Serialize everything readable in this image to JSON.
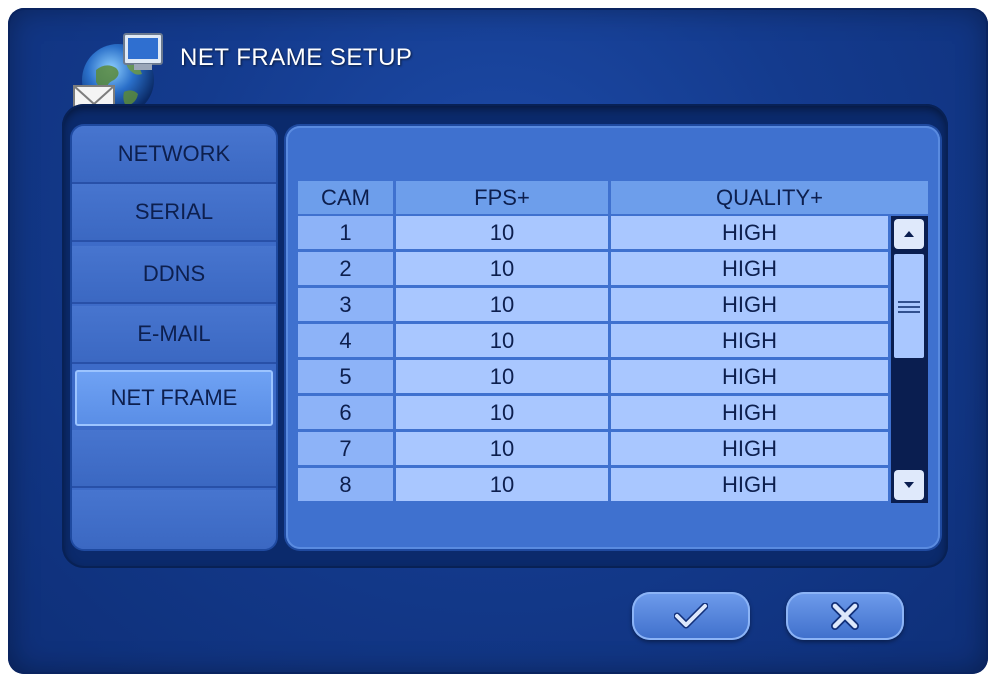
{
  "window": {
    "title": "NET FRAME SETUP"
  },
  "sidebar": {
    "items": [
      {
        "label": "NETWORK",
        "active": false
      },
      {
        "label": "SERIAL",
        "active": false
      },
      {
        "label": "DDNS",
        "active": false
      },
      {
        "label": "E-MAIL",
        "active": false
      },
      {
        "label": "NET FRAME",
        "active": true
      },
      {
        "label": "",
        "active": false
      },
      {
        "label": "",
        "active": false
      }
    ]
  },
  "table": {
    "headers": {
      "cam": "CAM",
      "fps": "FPS+",
      "quality": "QUALITY+"
    },
    "rows": [
      {
        "cam": "1",
        "fps": "10",
        "quality": "HIGH"
      },
      {
        "cam": "2",
        "fps": "10",
        "quality": "HIGH"
      },
      {
        "cam": "3",
        "fps": "10",
        "quality": "HIGH"
      },
      {
        "cam": "4",
        "fps": "10",
        "quality": "HIGH"
      },
      {
        "cam": "5",
        "fps": "10",
        "quality": "HIGH"
      },
      {
        "cam": "6",
        "fps": "10",
        "quality": "HIGH"
      },
      {
        "cam": "7",
        "fps": "10",
        "quality": "HIGH"
      },
      {
        "cam": "8",
        "fps": "10",
        "quality": "HIGH"
      }
    ]
  },
  "buttons": {
    "ok_icon": "check-icon",
    "cancel_icon": "close-icon"
  },
  "colors": {
    "background": "#143b8e",
    "panel": "#3f71cf",
    "cell": "#a9c7ff",
    "header": "#6d9eeb",
    "active_tab": "#6fa2f4"
  }
}
